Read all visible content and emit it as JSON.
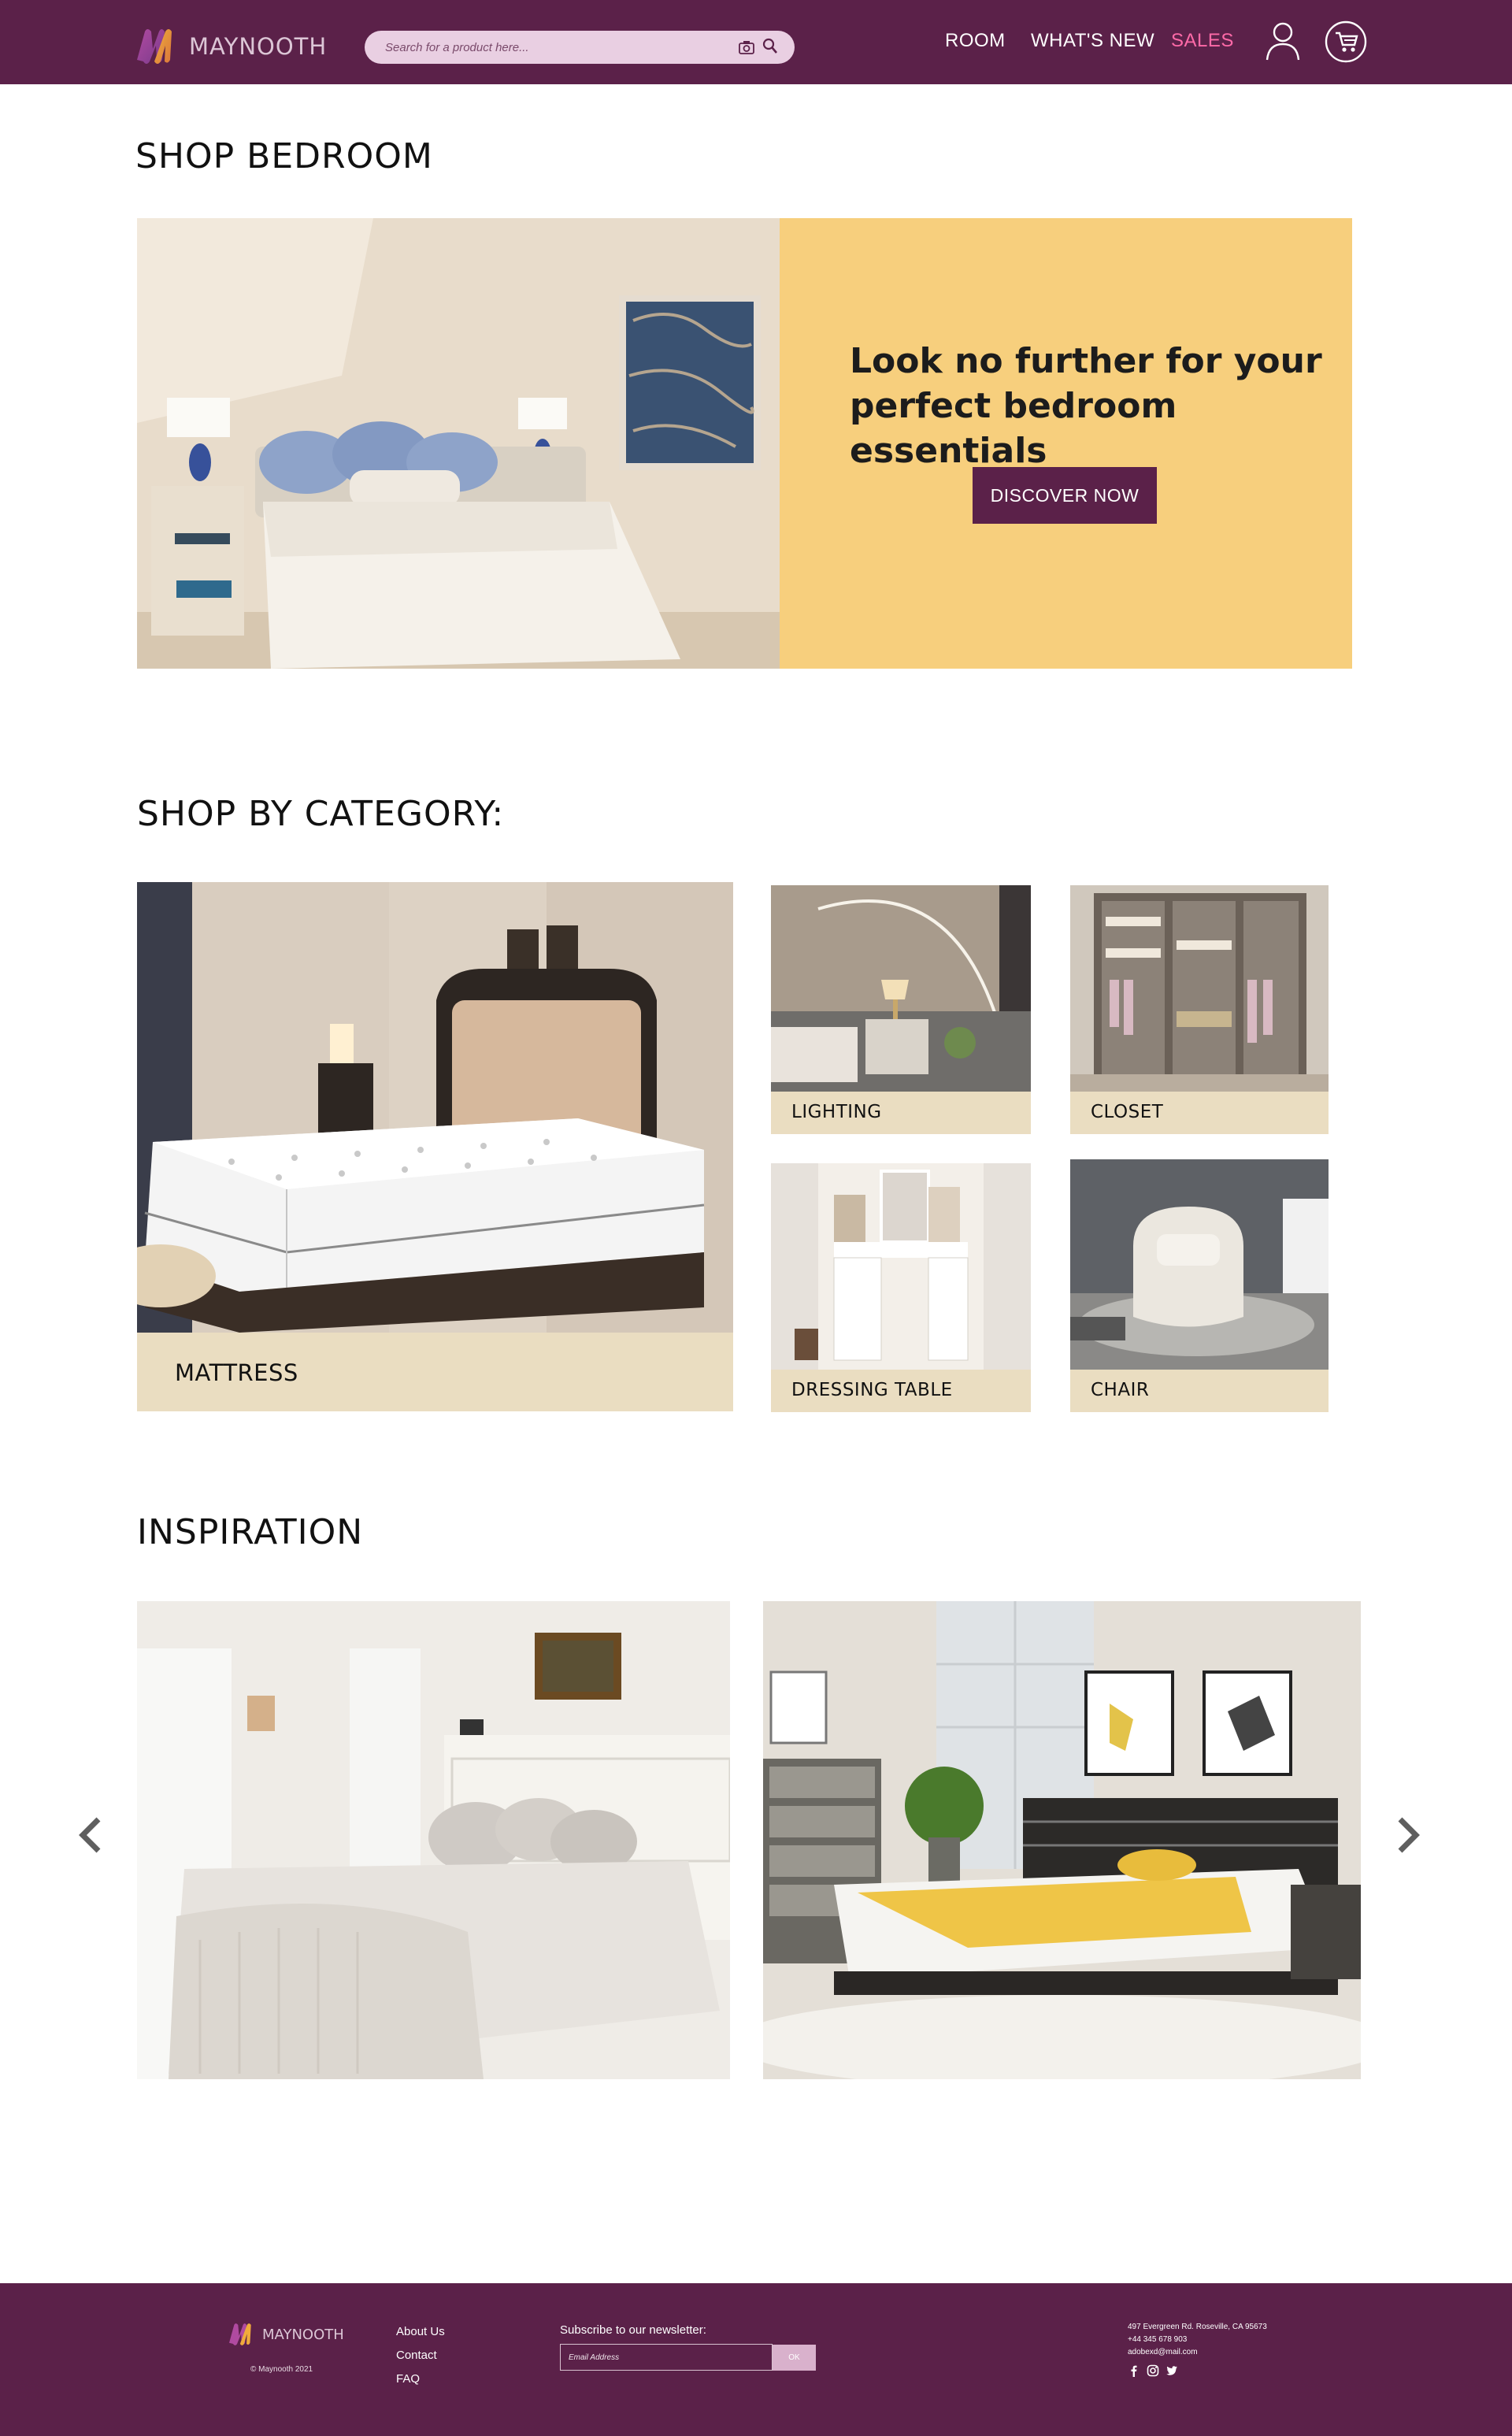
{
  "header": {
    "logo_text": "MAYNOOTH",
    "search_placeholder": "Search for a product here...",
    "nav": [
      "ROOM",
      "WHAT'S NEW",
      "SALES"
    ]
  },
  "bedroom": {
    "title": "SHOP BEDROOM",
    "hero_heading": "Look no further for your perfect bedroom essentials",
    "hero_button": "DISCOVER NOW"
  },
  "category": {
    "title": "SHOP BY CATEGORY:",
    "items": [
      "MATTRESS",
      "LIGHTING",
      "CLOSET",
      "DRESSING TABLE",
      "CHAIR"
    ]
  },
  "inspiration": {
    "title": "INSPIRATION"
  },
  "footer": {
    "logo_text": "MAYNOOTH",
    "copyright": "© Maynooth 2021",
    "links": [
      "About Us",
      "Contact",
      "FAQ"
    ],
    "newsletter_label": "Subscribe to our newsletter:",
    "email_placeholder": "Email Address",
    "ok_label": "OK",
    "address": "497 Evergreen Rd. Roseville, CA 95673",
    "phone": "+44 345 678 903",
    "email": "adobexd@mail.com",
    "social": [
      "facebook-icon",
      "instagram-icon",
      "twitter-icon"
    ]
  },
  "colors": {
    "brand": "#5b2149",
    "hero_panel": "#f7cf7d",
    "category_label_bg": "#eaddc1",
    "sales": "#ff6aa8",
    "search_bg": "#e9cfe2"
  }
}
